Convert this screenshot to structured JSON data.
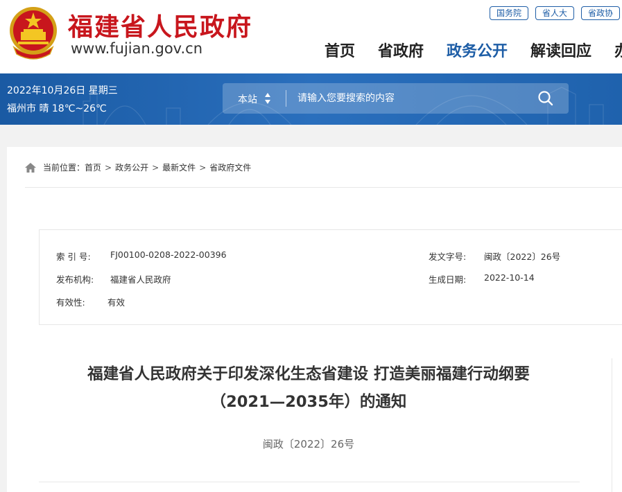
{
  "header": {
    "site_title": "福建省人民政府",
    "site_url": "www.fujian.gov.cn",
    "top_links": [
      "国务院",
      "省人大",
      "省政协"
    ],
    "nav": [
      {
        "label": "首页",
        "active": false
      },
      {
        "label": "省政府",
        "active": false
      },
      {
        "label": "政务公开",
        "active": true
      },
      {
        "label": "解读回应",
        "active": false
      },
      {
        "label": "办",
        "active": false
      }
    ]
  },
  "band": {
    "date": "2022年10月26日 星期三",
    "weather": "福州市 晴 18℃~26℃",
    "search_scope": "本站",
    "search_placeholder": "请输入您要搜索的内容"
  },
  "breadcrumb": {
    "prefix": "当前位置：",
    "items": [
      "首页",
      "政务公开",
      "最新文件",
      "省政府文件"
    ]
  },
  "meta": {
    "index_label": "索 引 号:",
    "index_value": "FJ00100-0208-2022-00396",
    "doc_no_label": "发文字号:",
    "doc_no_value": "闽政〔2022〕26号",
    "issuer_label": "发布机构:",
    "issuer_value": "福建省人民政府",
    "date_label": "生成日期:",
    "date_value": "2022-10-14",
    "validity_label": "有效性:",
    "validity_value": "有效"
  },
  "document": {
    "title_line1": "福建省人民政府关于印发深化生态省建设 打造美丽福建行动纲要",
    "title_line2": "（2021—2035年）的通知",
    "number": "闽政〔2022〕26号"
  },
  "colors": {
    "brand_red": "#c8161d",
    "brand_blue": "#1d5da6",
    "band_blue": "#1f62ad"
  }
}
